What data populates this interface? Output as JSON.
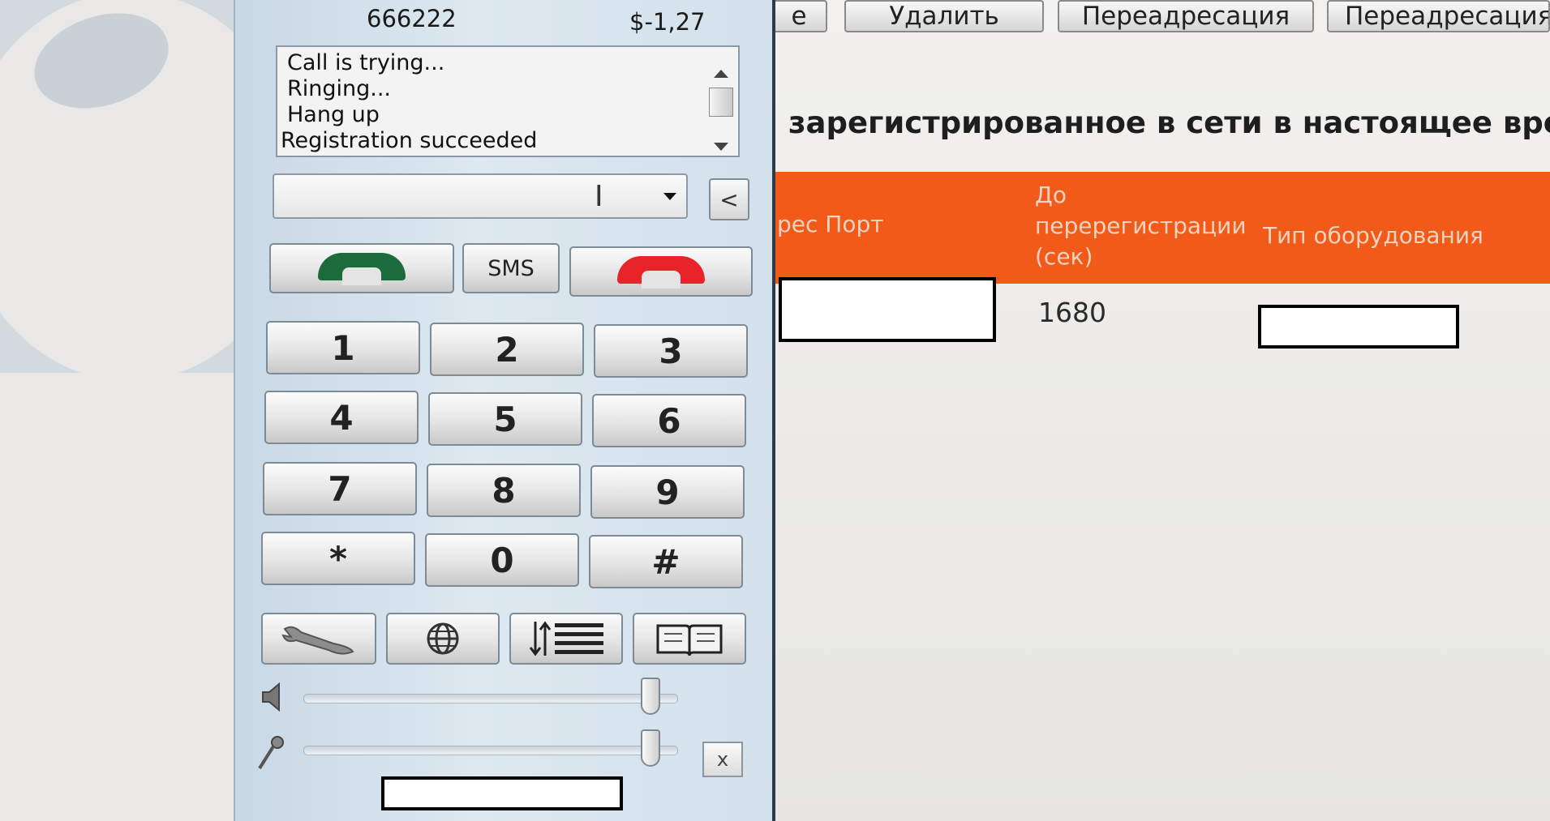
{
  "web": {
    "buttons": [
      {
        "label": "е"
      },
      {
        "label": "Удалить"
      },
      {
        "label": "Переадресация"
      },
      {
        "label": "Переадресация п"
      }
    ],
    "section_title": "зарегистрированное в сети в настоящее время",
    "table": {
      "headers": [
        "рес Порт",
        "До перерегистрации (сек)",
        "Тип оборудования"
      ],
      "row_value": "1680"
    }
  },
  "phone": {
    "number": "666222",
    "balance": "$-1,27",
    "log": [
      "Call is trying...",
      "Ringing...",
      "Hang up",
      "Registration succeeded"
    ],
    "back_label": "<",
    "sms_label": "SMS",
    "keys": [
      "1",
      "2",
      "3",
      "4",
      "5",
      "6",
      "7",
      "8",
      "9",
      "*",
      "0",
      "#"
    ],
    "close_label": "x",
    "colors": {
      "call": "#1c6b3c",
      "hangup": "#e8242a",
      "accent_orange": "#f25a1a"
    },
    "sliders": {
      "speaker_level": 0.93,
      "mic_level": 0.93
    }
  }
}
